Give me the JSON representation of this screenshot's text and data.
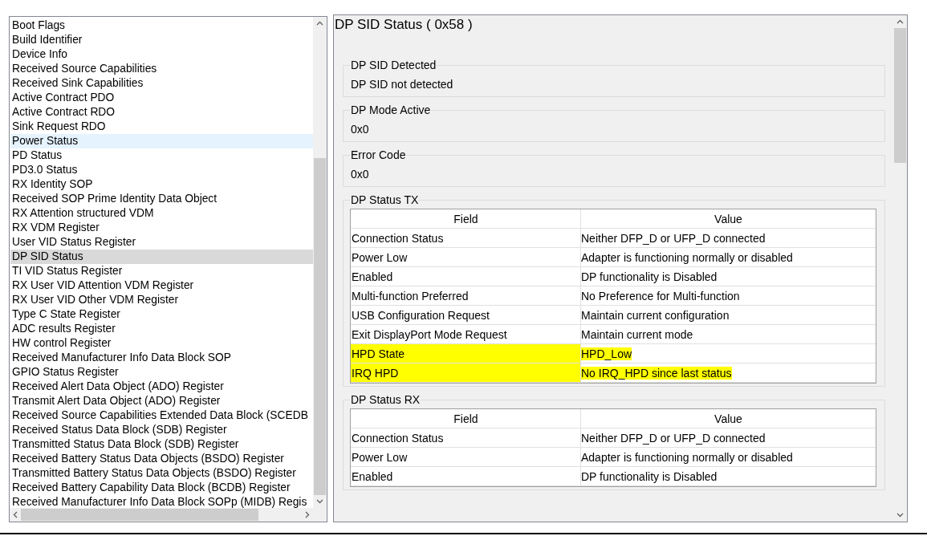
{
  "register_list": {
    "items": [
      {
        "label": "Boot Flags",
        "selected": false,
        "hovered": false
      },
      {
        "label": "Build Identifier",
        "selected": false,
        "hovered": false
      },
      {
        "label": "Device Info",
        "selected": false,
        "hovered": false
      },
      {
        "label": "Received Source Capabilities",
        "selected": false,
        "hovered": false
      },
      {
        "label": "Received Sink Capabilities",
        "selected": false,
        "hovered": false
      },
      {
        "label": "Active Contract PDO",
        "selected": false,
        "hovered": false
      },
      {
        "label": "Active Contract RDO",
        "selected": false,
        "hovered": false
      },
      {
        "label": "Sink Request RDO",
        "selected": false,
        "hovered": false
      },
      {
        "label": "Power Status",
        "selected": false,
        "hovered": true
      },
      {
        "label": "PD Status",
        "selected": false,
        "hovered": false
      },
      {
        "label": "PD3.0 Status",
        "selected": false,
        "hovered": false
      },
      {
        "label": "RX Identity SOP",
        "selected": false,
        "hovered": false
      },
      {
        "label": "Received SOP Prime Identity Data Object",
        "selected": false,
        "hovered": false
      },
      {
        "label": "RX Attention structured VDM",
        "selected": false,
        "hovered": false
      },
      {
        "label": "RX VDM Register",
        "selected": false,
        "hovered": false
      },
      {
        "label": "User VID Status Register",
        "selected": false,
        "hovered": false
      },
      {
        "label": "DP SID Status",
        "selected": true,
        "hovered": false
      },
      {
        "label": "TI VID Status Register",
        "selected": false,
        "hovered": false
      },
      {
        "label": "RX User VID Attention VDM Register",
        "selected": false,
        "hovered": false
      },
      {
        "label": "RX User VID Other VDM Register",
        "selected": false,
        "hovered": false
      },
      {
        "label": "Type C State Register",
        "selected": false,
        "hovered": false
      },
      {
        "label": "ADC results Register",
        "selected": false,
        "hovered": false
      },
      {
        "label": "HW control Register",
        "selected": false,
        "hovered": false
      },
      {
        "label": "Received Manufacturer Info Data Block SOP",
        "selected": false,
        "hovered": false
      },
      {
        "label": "GPIO Status Register",
        "selected": false,
        "hovered": false
      },
      {
        "label": "Received Alert Data Object (ADO) Register",
        "selected": false,
        "hovered": false
      },
      {
        "label": "Transmit Alert Data Object (ADO) Register",
        "selected": false,
        "hovered": false
      },
      {
        "label": "Received Source Capabilities Extended Data Block (SCEDB",
        "selected": false,
        "hovered": false
      },
      {
        "label": "Received Status Data Block (SDB) Register",
        "selected": false,
        "hovered": false
      },
      {
        "label": "Transmitted Status Data Block (SDB) Register",
        "selected": false,
        "hovered": false
      },
      {
        "label": "Received Battery Status Data Objects (BSDO) Register",
        "selected": false,
        "hovered": false
      },
      {
        "label": "Transmitted Battery Status Data Objects (BSDO) Register",
        "selected": false,
        "hovered": false
      },
      {
        "label": "Received Battery Capability Data Block (BCDB) Register",
        "selected": false,
        "hovered": false
      },
      {
        "label": "Received Manufacturer Info Data Block SOPp (MIDB) Regis",
        "selected": false,
        "hovered": false
      }
    ]
  },
  "detail": {
    "title": "DP SID Status  ( 0x58 )",
    "groups": [
      {
        "kind": "value",
        "label": "DP SID Detected",
        "value": "DP SID not detected"
      },
      {
        "kind": "value",
        "label": "DP Mode Active",
        "value": "0x0"
      },
      {
        "kind": "value",
        "label": "Error Code",
        "value": "0x0"
      },
      {
        "kind": "table",
        "label": "DP Status TX",
        "columns": [
          "Field",
          "Value"
        ],
        "rows": [
          {
            "field": "Connection Status",
            "value": "Neither DFP_D or UFP_D connected",
            "highlighted": false
          },
          {
            "field": "Power Low",
            "value": "Adapter is functioning normally or disabled",
            "highlighted": false
          },
          {
            "field": "Enabled",
            "value": "DP functionality is Disabled",
            "highlighted": false
          },
          {
            "field": "Multi-function Preferred",
            "value": "No Preference for Multi-function",
            "highlighted": false
          },
          {
            "field": "USB Configuration Request",
            "value": "Maintain current configuration",
            "highlighted": false
          },
          {
            "field": "Exit DisplayPort Mode Request",
            "value": "Maintain current mode",
            "highlighted": false
          },
          {
            "field": "HPD State",
            "value": "HPD_Low",
            "highlighted": true
          },
          {
            "field": "IRQ HPD",
            "value": "No IRQ_HPD since last status",
            "highlighted": true
          }
        ]
      },
      {
        "kind": "table",
        "label": "DP Status RX",
        "columns": [
          "Field",
          "Value"
        ],
        "rows": [
          {
            "field": "Connection Status",
            "value": "Neither DFP_D or UFP_D connected",
            "highlighted": false
          },
          {
            "field": "Power Low",
            "value": "Adapter is functioning normally or disabled",
            "highlighted": false
          },
          {
            "field": "Enabled",
            "value": "DP functionality is Disabled",
            "highlighted": false
          }
        ]
      }
    ]
  }
}
